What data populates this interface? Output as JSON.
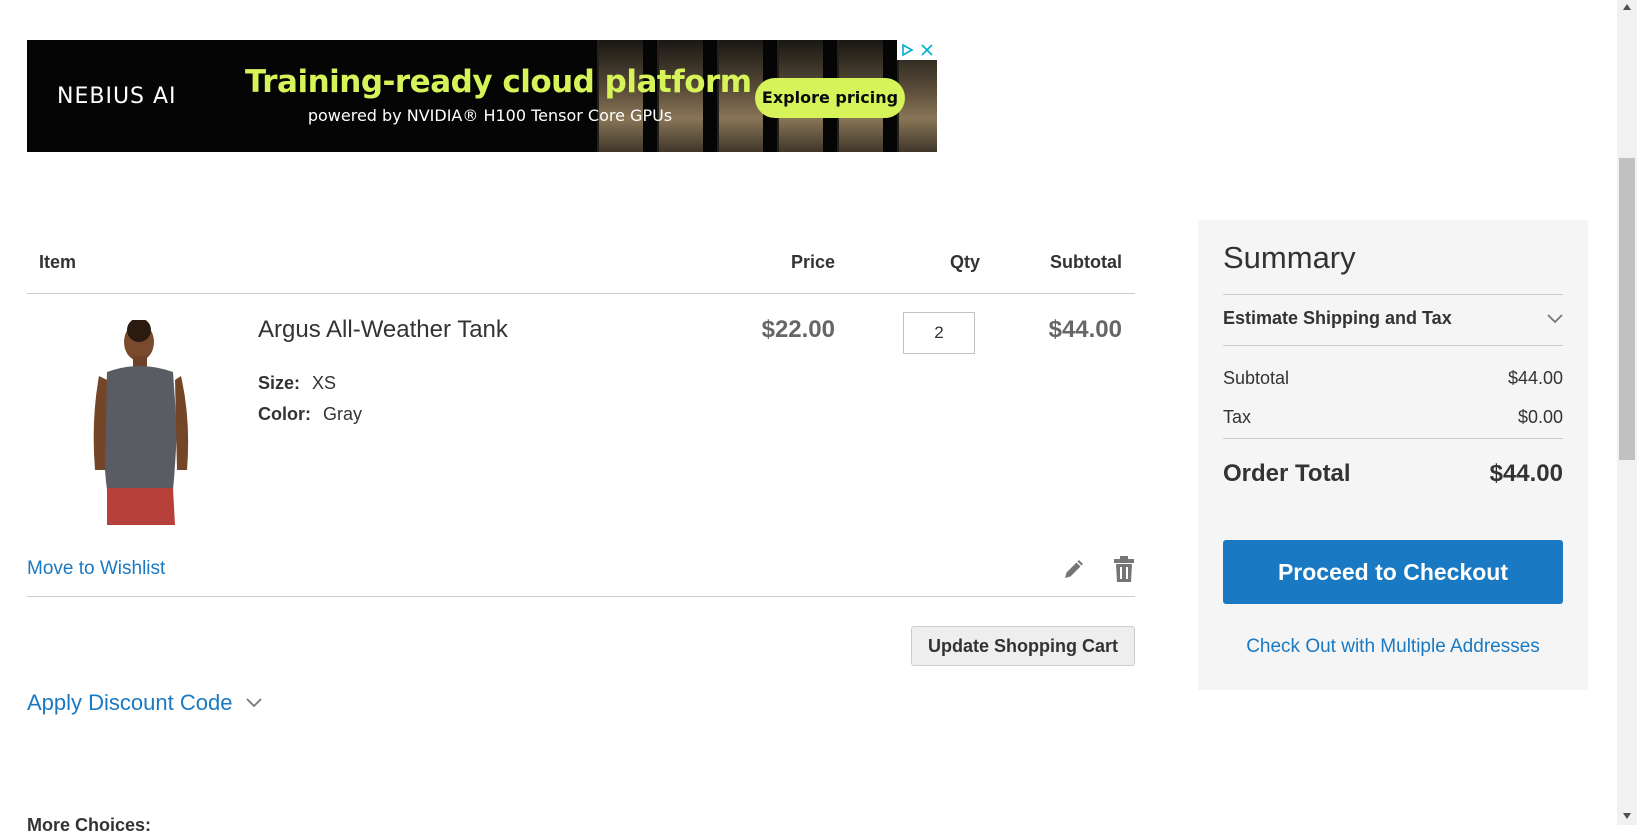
{
  "ad": {
    "logo": "NEBIUS AI",
    "headline": "Training-ready cloud platform",
    "subline": "powered by NVIDIA® H100 Tensor Core GPUs",
    "cta": "Explore pricing"
  },
  "cart": {
    "headers": {
      "item": "Item",
      "price": "Price",
      "qty": "Qty",
      "subtotal": "Subtotal"
    },
    "items": [
      {
        "name": "Argus All-Weather Tank",
        "options": [
          {
            "label": "Size:",
            "value": "XS"
          },
          {
            "label": "Color:",
            "value": "Gray"
          }
        ],
        "price": "$22.00",
        "qty": "2",
        "subtotal": "$44.00",
        "wishlist_label": "Move to Wishlist"
      }
    ],
    "update_label": "Update Shopping Cart",
    "discount_label": "Apply Discount Code",
    "more_choices": "More Choices:"
  },
  "summary": {
    "title": "Summary",
    "shipping_toggle": "Estimate Shipping and Tax",
    "subtotal_label": "Subtotal",
    "subtotal_value": "$44.00",
    "tax_label": "Tax",
    "tax_value": "$0.00",
    "total_label": "Order Total",
    "total_value": "$44.00",
    "checkout_label": "Proceed to Checkout",
    "multi_label": "Check Out with Multiple Addresses"
  },
  "colors": {
    "link": "#1979c3",
    "primary_button": "#1979c3",
    "ad_accent": "#d7f35a",
    "summary_bg": "#f5f5f5"
  },
  "icons": [
    "ad-choices-icon",
    "close-icon",
    "edit-pencil-icon",
    "trash-icon",
    "chevron-down-icon"
  ]
}
